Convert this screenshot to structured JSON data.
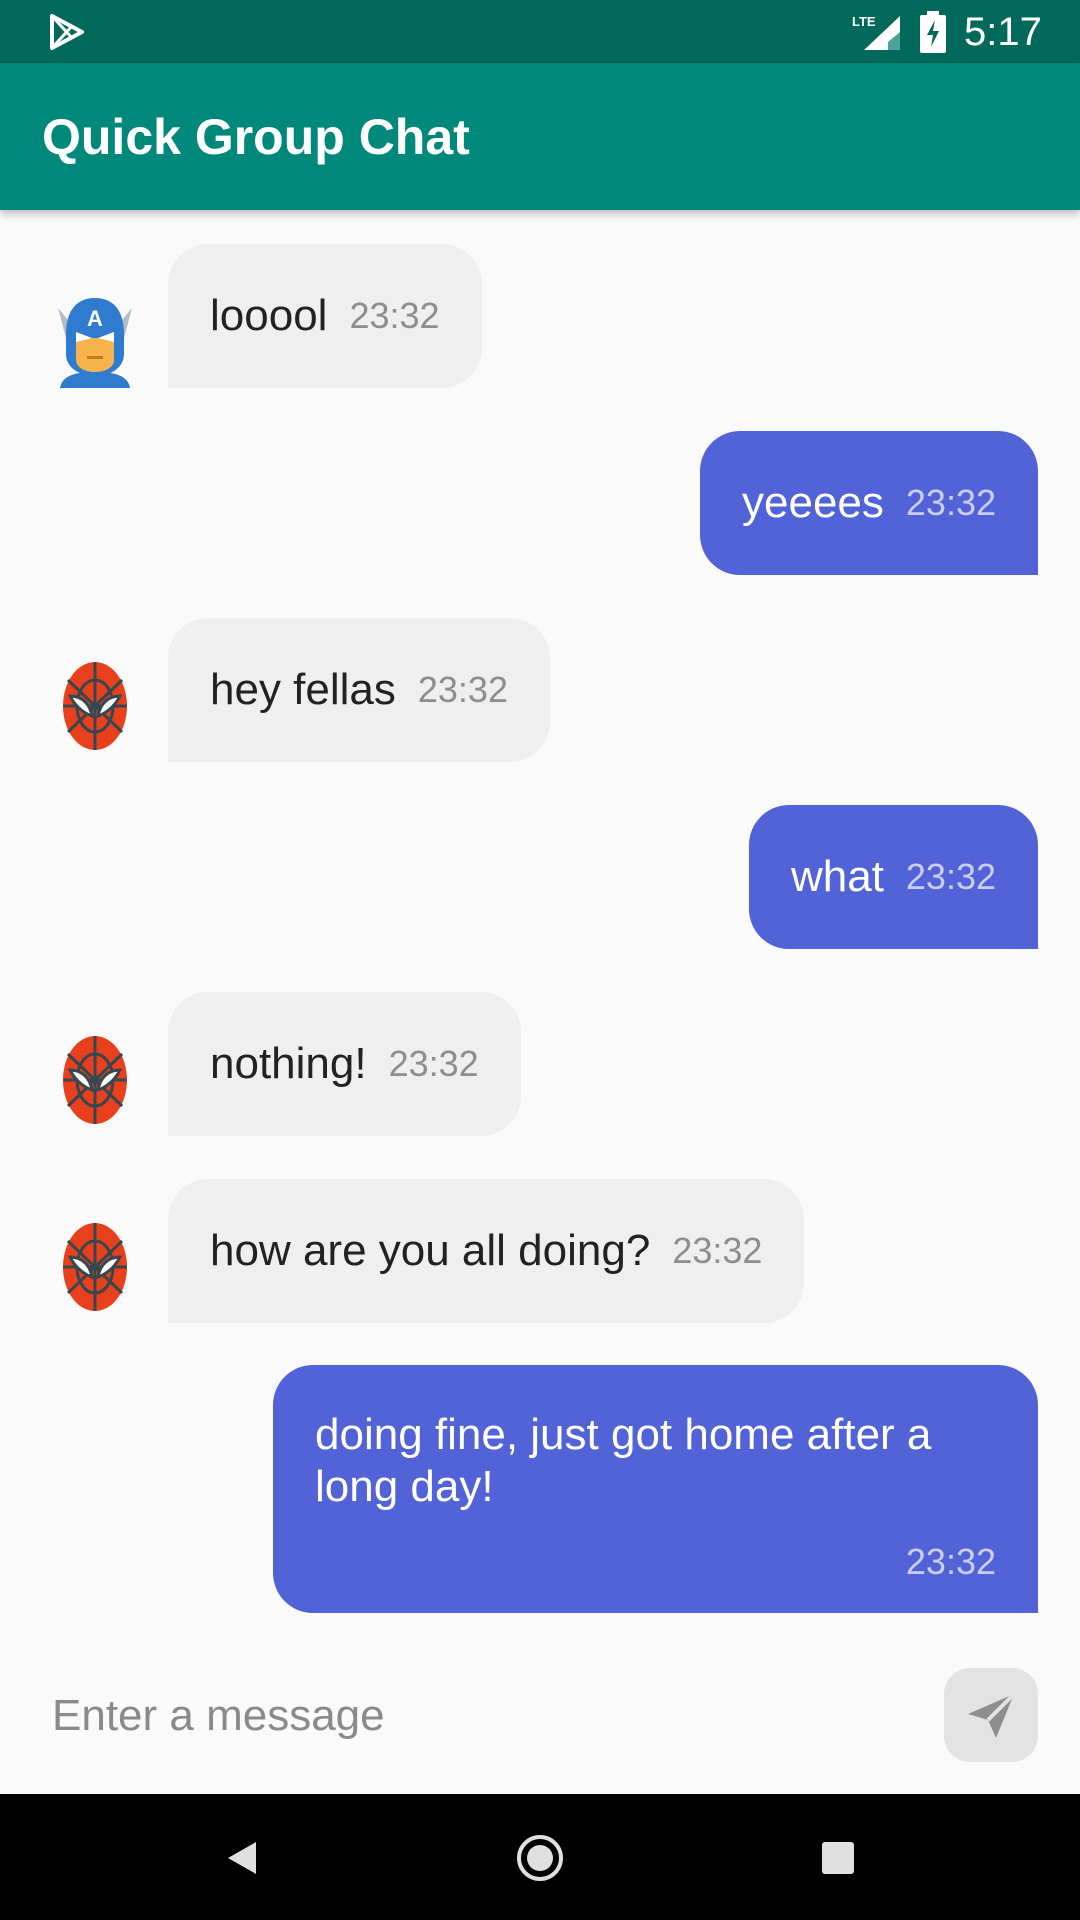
{
  "status_bar": {
    "time": "5:17",
    "network": "LTE",
    "icons": [
      "play-store-icon",
      "signal-icon",
      "battery-charging-icon"
    ]
  },
  "app_bar": {
    "title": "Quick Group Chat"
  },
  "messages": [
    {
      "direction": "incoming",
      "avatar": "captain-america-avatar",
      "text": "looool",
      "time": "23:32"
    },
    {
      "direction": "outgoing",
      "text": "yeeees",
      "time": "23:32"
    },
    {
      "direction": "incoming",
      "avatar": "spiderman-avatar",
      "text": "hey fellas",
      "time": "23:32"
    },
    {
      "direction": "outgoing",
      "text": "what",
      "time": "23:32"
    },
    {
      "direction": "incoming",
      "avatar": "spiderman-avatar",
      "text": "nothing!",
      "time": "23:32"
    },
    {
      "direction": "incoming",
      "avatar": "spiderman-avatar",
      "text": "how are you all doing?",
      "time": "23:32"
    },
    {
      "direction": "outgoing",
      "text": "doing fine, just got home after a long day!",
      "time": "23:32"
    }
  ],
  "composer": {
    "placeholder": "Enter a message",
    "send_icon": "send-icon"
  },
  "navigation": {
    "icons": [
      "back-icon",
      "home-icon",
      "recents-icon"
    ]
  },
  "colors": {
    "status_bar": "#00695C",
    "app_bar": "#00897B",
    "outgoing_bubble": "#5163D6",
    "incoming_bubble": "#EFEFEF",
    "background": "#FAFAFA"
  }
}
